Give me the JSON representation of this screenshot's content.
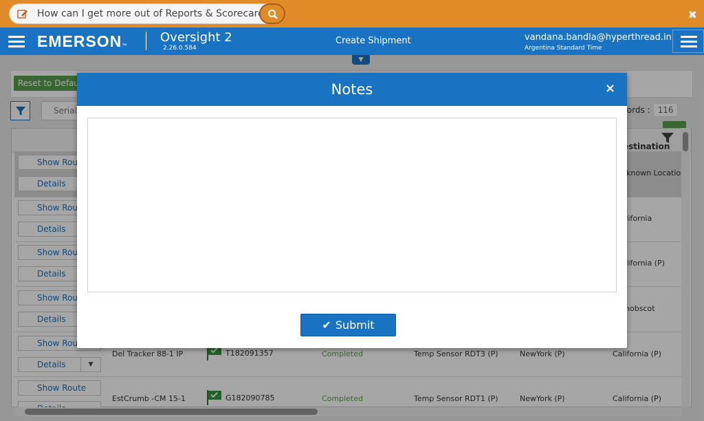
{
  "help_bar": {
    "question": "How can I get more out of Reports & Scorecards?",
    "edit_icon": "edit-icon",
    "search_icon": "search-icon",
    "close_icon": "close-icon"
  },
  "header": {
    "brand": "EMERSON",
    "brand_mark": "™",
    "app_name": "Oversight 2",
    "version": "2.26.0.584",
    "page_title": "Create Shipment",
    "user_email": "vandana.bandla@hyperthread.in",
    "timezone": "Argentina Standard Time",
    "colors": {
      "accent": "#1a72c2",
      "help_bar": "#e08a28",
      "success": "#56a04a"
    }
  },
  "toolbar": {
    "reset_label": "Reset to Default",
    "serial_label": "Serial",
    "records_label": "Records :",
    "records_count": "116",
    "destination_header": "Destination"
  },
  "rows": [
    {
      "show_route": "Show Route",
      "details": "Details",
      "name": "",
      "serial": "",
      "status": "",
      "sensor": "",
      "origin": "",
      "destination": "Unknown Location",
      "selected": true
    },
    {
      "show_route": "Show Route",
      "details": "Details",
      "name": "",
      "serial": "",
      "status": "",
      "sensor": "",
      "origin": "",
      "destination": "California"
    },
    {
      "show_route": "Show Route",
      "details": "Details",
      "name": "",
      "serial": "",
      "status": "",
      "sensor": "",
      "origin": "",
      "destination": "California (P)"
    },
    {
      "show_route": "Show Route",
      "details": "Details",
      "name": "",
      "serial": "",
      "status": "",
      "sensor": "",
      "origin": "",
      "destination": "Penobscot"
    },
    {
      "show_route": "Show Route",
      "details": "Details",
      "name": "Del Tracker 88-1 IP",
      "serial": "T182091357",
      "status": "Completed",
      "sensor": "Temp Sensor RDT3 (P)",
      "origin": "NewYork (P)",
      "destination": "California (P)"
    },
    {
      "show_route": "Show Route",
      "details": "Details",
      "name": "EstCrumb -CM 15-1",
      "serial": "G182090785",
      "status": "Completed",
      "sensor": "Temp Sensor RDT1 (P)",
      "origin": "NewYork (P)",
      "destination": "California (P)"
    }
  ],
  "modal": {
    "title": "Notes",
    "close": "×",
    "notes_value": "",
    "submit_label": "Submit"
  }
}
